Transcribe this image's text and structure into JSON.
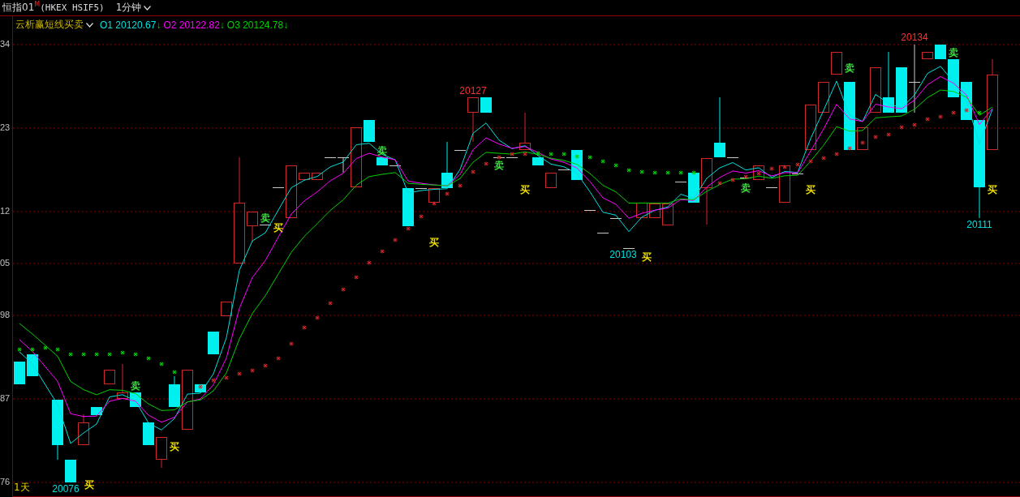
{
  "header": {
    "symbol": "恒指01$^{M}$",
    "exchange_code": "(HKEX HSIF5)",
    "period": "1分钟"
  },
  "indicator": {
    "name": "云析赢短线买卖",
    "values": [
      {
        "label": "O1",
        "value": "20120.67",
        "arrow": "↓",
        "color": "#00e0e0"
      },
      {
        "label": "O2",
        "value": "20122.82",
        "arrow": "↓",
        "color": "#ff00ff"
      },
      {
        "label": "O3",
        "value": "20124.78",
        "arrow": "↓",
        "color": "#00d000"
      }
    ]
  },
  "y_axis_labels": [
    "34",
    "23",
    "12",
    "05",
    "98",
    "87",
    "76"
  ],
  "price_labels": [
    {
      "text": "20076",
      "kind": "low"
    },
    {
      "text": "20127",
      "kind": "high"
    },
    {
      "text": "20103",
      "kind": "low"
    },
    {
      "text": "20134",
      "kind": "high"
    },
    {
      "text": "20111",
      "kind": "low"
    }
  ],
  "signals": [
    {
      "text": "买",
      "kind": "buy"
    },
    {
      "text": "卖",
      "kind": "sell"
    },
    {
      "text": "买",
      "kind": "buy"
    },
    {
      "text": "卖",
      "kind": "sell"
    },
    {
      "text": "买",
      "kind": "buy"
    },
    {
      "text": "卖",
      "kind": "sell"
    },
    {
      "text": "买",
      "kind": "buy"
    },
    {
      "text": "卖",
      "kind": "sell"
    },
    {
      "text": "买",
      "kind": "buy"
    },
    {
      "text": "买",
      "kind": "buy"
    },
    {
      "text": "卖",
      "kind": "sell"
    },
    {
      "text": "买",
      "kind": "buy"
    },
    {
      "text": "卖",
      "kind": "sell"
    },
    {
      "text": "卖",
      "kind": "sell"
    },
    {
      "text": "买",
      "kind": "buy"
    }
  ],
  "timeframe_label": "1天"
}
